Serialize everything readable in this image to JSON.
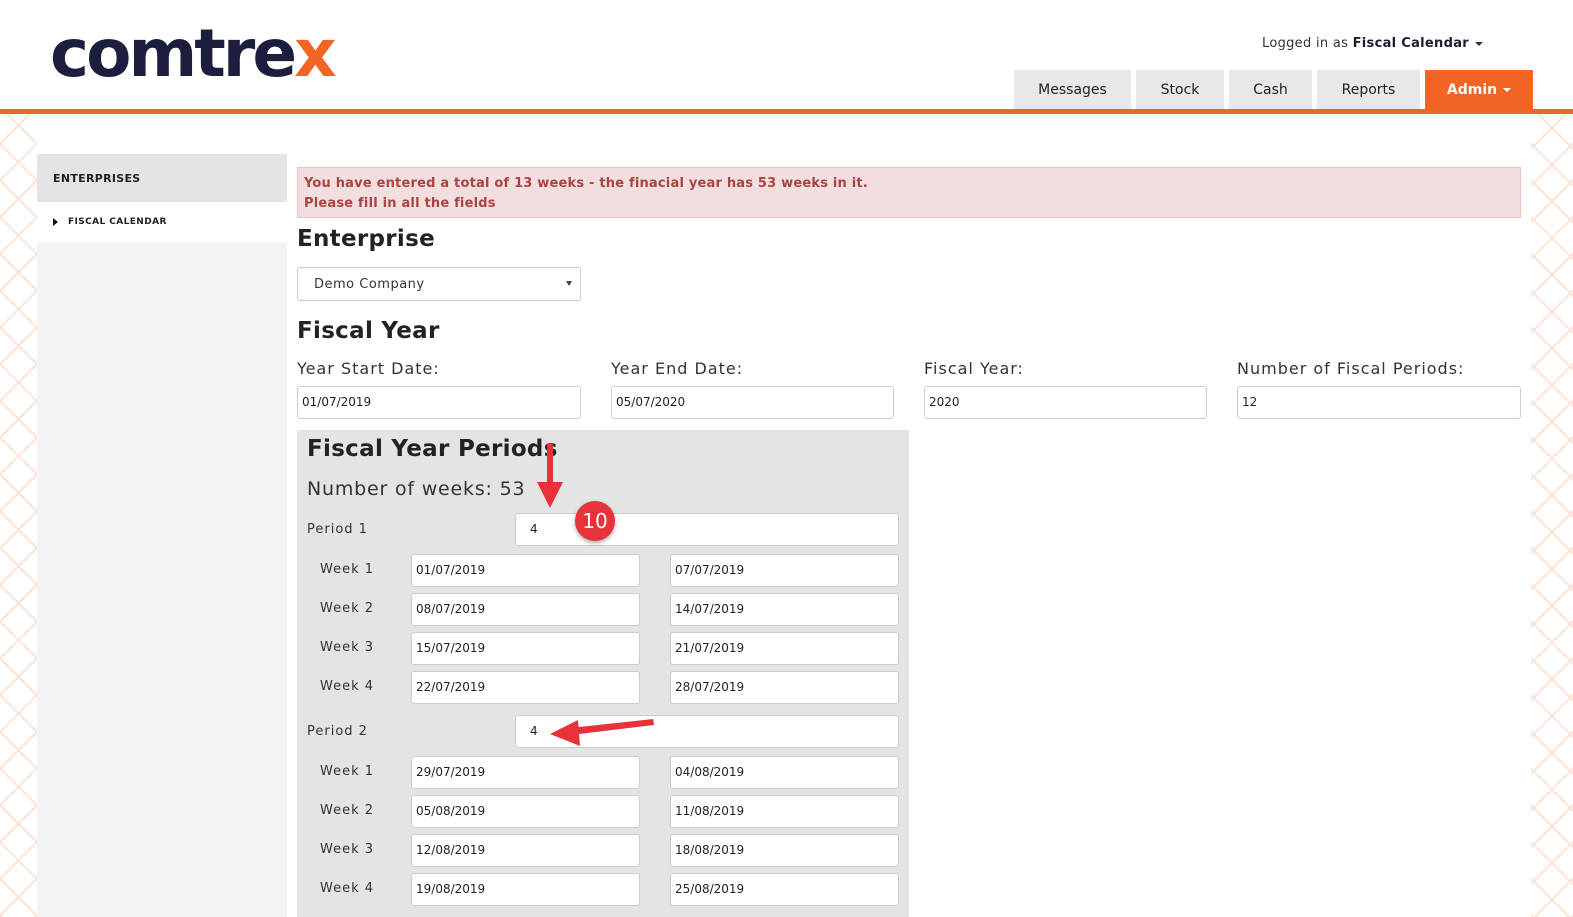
{
  "header": {
    "logo_main": "comtre",
    "logo_accent": "x",
    "login_prefix": "Logged in as",
    "login_user": "Fiscal Calendar",
    "nav": [
      "Messages",
      "Stock",
      "Cash",
      "Reports",
      "Admin"
    ]
  },
  "sidebar": {
    "heading": "ENTERPRISES",
    "items": [
      "FISCAL CALENDAR"
    ]
  },
  "alert": {
    "line1": "You have entered a total of 13 weeks - the finacial year has 53 weeks in it.",
    "line2": "Please fill in all the fields"
  },
  "enterprise": {
    "heading": "Enterprise",
    "selected": "Demo Company"
  },
  "fiscal_year": {
    "heading": "Fiscal Year",
    "start_label": "Year Start Date:",
    "start_value": "01/07/2019",
    "end_label": "Year End Date:",
    "end_value": "05/07/2020",
    "year_label": "Fiscal Year:",
    "year_value": "2020",
    "periods_label": "Number of Fiscal Periods:",
    "periods_value": "12"
  },
  "periods": {
    "heading": "Fiscal Year Periods",
    "weeks_total": "Number of weeks: 53",
    "list": [
      {
        "label": "Period 1",
        "value": "4",
        "weeks": [
          {
            "label": "Week 1",
            "start": "01/07/2019",
            "end": "07/07/2019"
          },
          {
            "label": "Week 2",
            "start": "08/07/2019",
            "end": "14/07/2019"
          },
          {
            "label": "Week 3",
            "start": "15/07/2019",
            "end": "21/07/2019"
          },
          {
            "label": "Week 4",
            "start": "22/07/2019",
            "end": "28/07/2019"
          }
        ]
      },
      {
        "label": "Period 2",
        "value": "4",
        "weeks": [
          {
            "label": "Week 1",
            "start": "29/07/2019",
            "end": "04/08/2019"
          },
          {
            "label": "Week 2",
            "start": "05/08/2019",
            "end": "11/08/2019"
          },
          {
            "label": "Week 3",
            "start": "12/08/2019",
            "end": "18/08/2019"
          },
          {
            "label": "Week 4",
            "start": "19/08/2019",
            "end": "25/08/2019"
          }
        ]
      }
    ]
  },
  "annotation": {
    "marker": "10",
    "color": "#e8323a"
  },
  "colors": {
    "brand_orange": "#f26522",
    "logo_navy": "#1d1d3d",
    "alert_bg": "#f2dede",
    "alert_text": "#a94442"
  }
}
